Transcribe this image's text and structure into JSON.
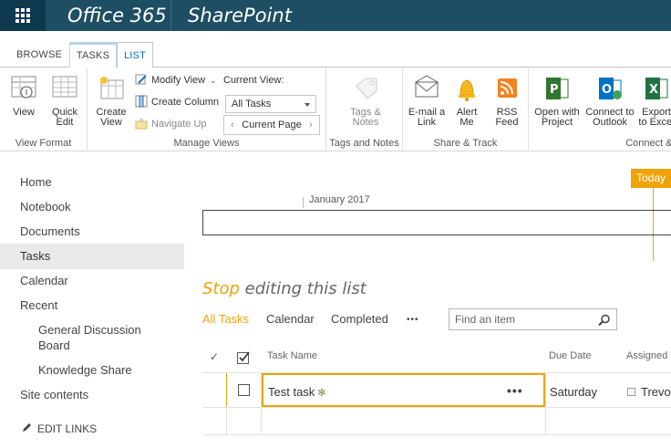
{
  "suite": {
    "brand": "Office 365",
    "app": "SharePoint"
  },
  "ribbon_tabs": [
    "BROWSE",
    "TASKS",
    "LIST"
  ],
  "ribbon": {
    "view_format": {
      "view": "View",
      "quick_edit": "Quick Edit",
      "label": "View Format"
    },
    "manage_views": {
      "create_view": "Create View",
      "modify_view": "Modify View",
      "create_column": "Create Column",
      "navigate_up": "Navigate Up",
      "current_view_label": "Current View:",
      "current_view_value": "All Tasks",
      "current_page": "Current Page",
      "label": "Manage Views"
    },
    "tags_notes": {
      "tags_notes": "Tags & Notes",
      "label": "Tags and Notes"
    },
    "share_track": {
      "email_link": "E-mail a Link",
      "alert_me": "Alert Me",
      "rss_feed": "RSS Feed",
      "label": "Share & Track"
    },
    "connect_export": {
      "open_project": "Open with Project",
      "connect_outlook": "Connect to Outlook",
      "export_excel": "Export to Excel",
      "label": "Connect & E"
    }
  },
  "nav": {
    "items": [
      "Home",
      "Notebook",
      "Documents",
      "Tasks",
      "Calendar",
      "Recent"
    ],
    "recent": [
      "General Discussion Board",
      "Knowledge Share"
    ],
    "site_contents": "Site contents",
    "edit_links": "EDIT LINKS",
    "selected": "Tasks"
  },
  "timeline": {
    "today": "Today",
    "month": "January 2017"
  },
  "edit_banner": {
    "accent": "Stop",
    "rest": " editing this list"
  },
  "views": {
    "all_tasks": "All Tasks",
    "calendar": "Calendar",
    "completed": "Completed",
    "more": "•••"
  },
  "search": {
    "placeholder": "Find an item"
  },
  "table": {
    "headers": {
      "task_name": "Task Name",
      "due_date": "Due Date",
      "assigned_to": "Assigned T"
    },
    "rows": [
      {
        "task_name": "Test task",
        "due_date": "Saturday",
        "assigned_to": "Trevor",
        "new": "✻",
        "menu": "•••"
      }
    ]
  },
  "colors": {
    "suite_bar": "#1e4e63",
    "accent": "#f0a30a",
    "link": "#0072c6"
  }
}
